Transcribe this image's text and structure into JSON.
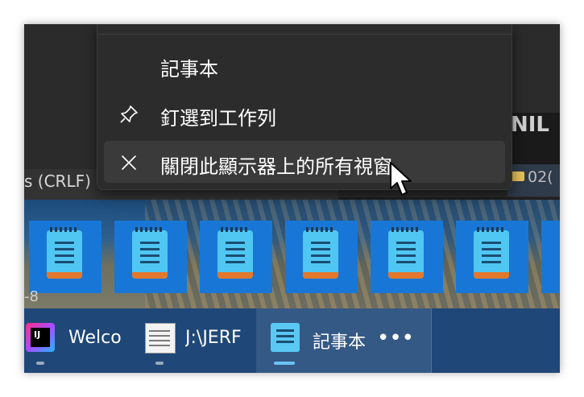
{
  "background_window": {
    "status_encoding": "s (CRLF)",
    "folder_label": "02(",
    "right_text": "NIL"
  },
  "desktop": {
    "thumbnail_caption": "-8",
    "thumbnail_count": 7
  },
  "jump_list": {
    "app_name": "記事本",
    "pin_label": "釘選到工作列",
    "close_all_label": "關閉此顯示器上的所有視窗",
    "hovered_item": "close_all"
  },
  "taskbar": {
    "items": [
      {
        "name": "IntelliJ IDEA",
        "label": "Welco",
        "icon_text": "IJ"
      },
      {
        "name": "Notepad legacy",
        "label": "J:\\JERF"
      },
      {
        "name": "Notepad",
        "label": "記事本",
        "active": true
      }
    ],
    "more_label": "•••"
  },
  "colors": {
    "taskbar": "#1f4778",
    "menu_bg": "#2c2c2c",
    "menu_hover": "#3a3a3a",
    "accent": "#6cc4f5",
    "notepad_tile": "#1877d6"
  }
}
